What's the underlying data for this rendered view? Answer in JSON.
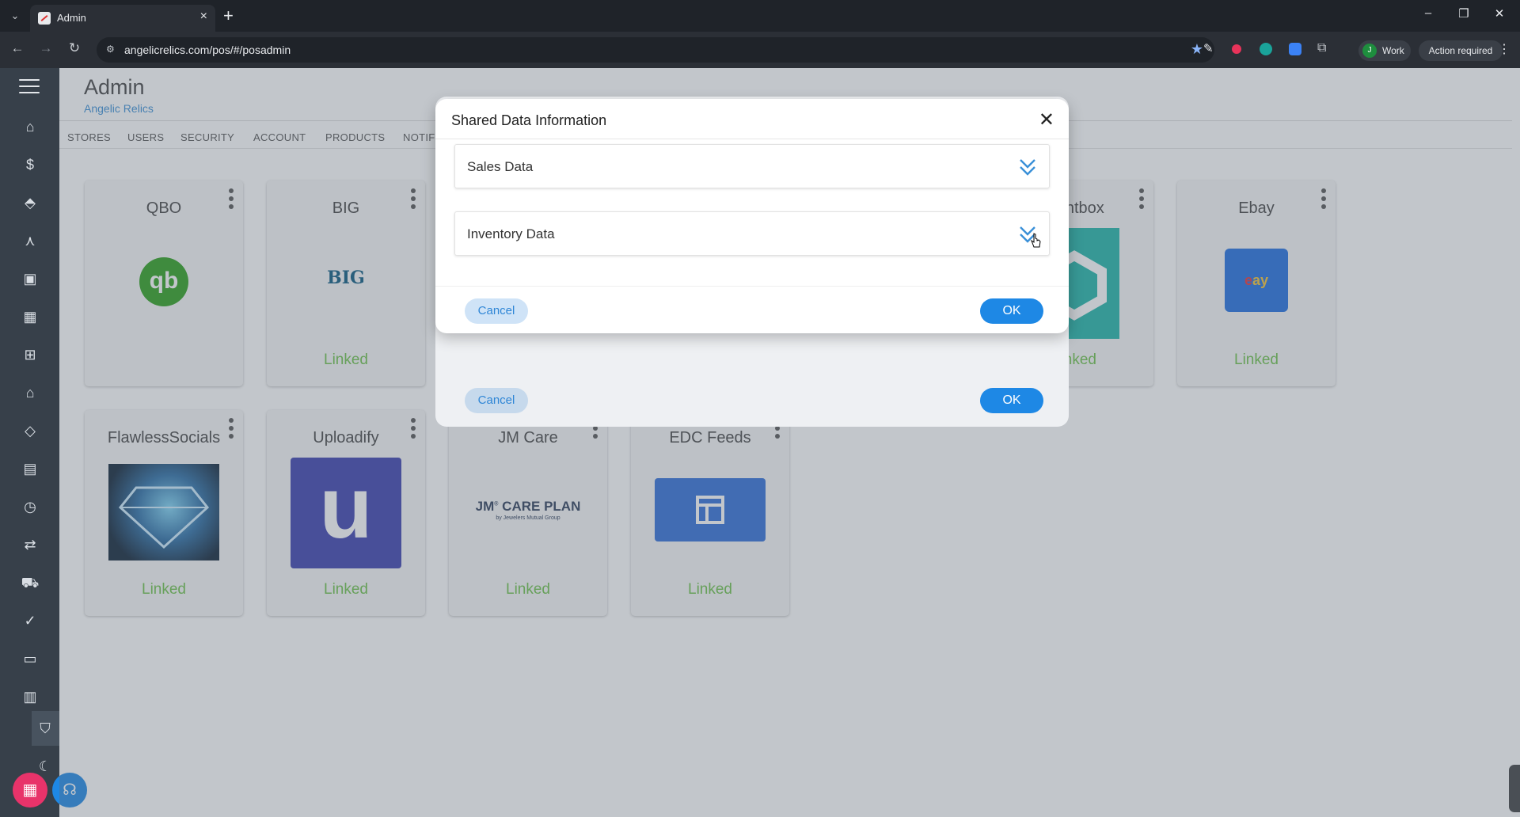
{
  "browser": {
    "tab_title": "Admin",
    "url": "angelicrelics.com/pos/#/posadmin",
    "profile_initial": "J",
    "profile_label": "Work",
    "action_label": "Action required"
  },
  "app": {
    "title": "Admin",
    "subtitle": "Angelic Relics",
    "tabs": [
      "STORES",
      "USERS",
      "SECURITY",
      "ACCOUNT",
      "PRODUCTS",
      "NOTIF"
    ]
  },
  "integrations": [
    {
      "name": "QBO",
      "status": ""
    },
    {
      "name": "BIG",
      "status": "Linked",
      "logo_text": "BIG"
    },
    {
      "name": "Lightbox",
      "status": "Linked"
    },
    {
      "name": "Ebay",
      "status": "Linked",
      "logo_text": "ay"
    },
    {
      "name": "FlawlessSocials",
      "status": "Linked"
    },
    {
      "name": "Uploadify",
      "status": "Linked"
    },
    {
      "name": "JM Care",
      "status": "Linked",
      "logo_line1": "JM",
      "logo_line1b": "CARE PLAN",
      "logo_line2": "by Jewelers Mutual Group"
    },
    {
      "name": "EDC Feeds",
      "status": "Linked"
    }
  ],
  "dialog": {
    "title": "Shared Data Information",
    "sections": [
      "Sales Data",
      "Inventory Data"
    ],
    "cancel_label": "Cancel",
    "ok_label": "OK"
  },
  "back_dialog": {
    "cancel_label": "Cancel",
    "ok_label": "OK"
  },
  "colors": {
    "accent": "#1e88e5",
    "linked": "#6cc24a",
    "sidebar": "#37404a"
  }
}
